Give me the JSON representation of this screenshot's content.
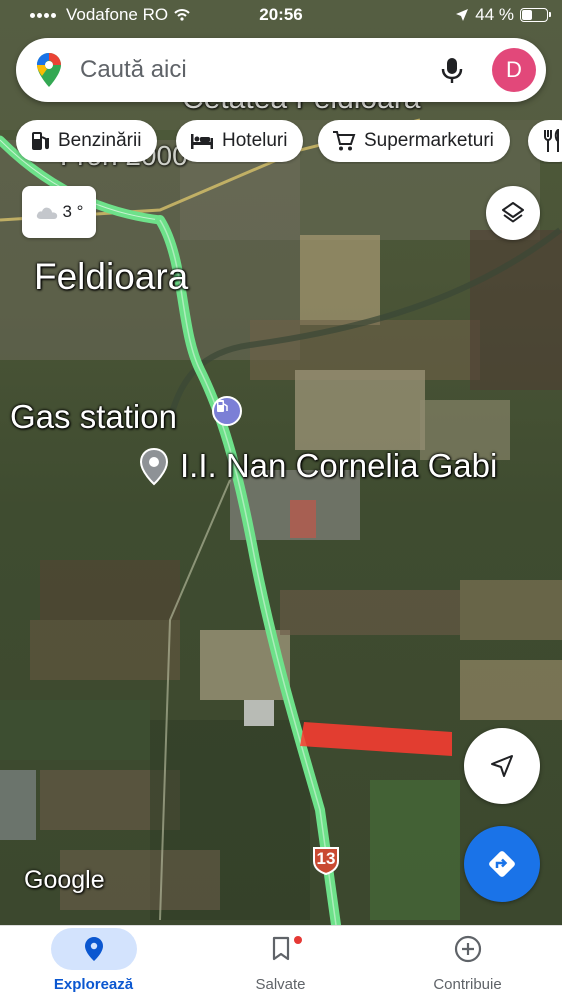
{
  "status_bar": {
    "carrier": "Vodafone RO",
    "time": "20:56",
    "battery": "44 %",
    "battery_level": 0.44
  },
  "search": {
    "placeholder": "Caută aici",
    "avatar_letter": "D",
    "avatar_color": "#e2487a"
  },
  "chips": [
    {
      "label": "Benzinării",
      "icon": "gas-pump-icon"
    },
    {
      "label": "Hoteluri",
      "icon": "bed-icon"
    },
    {
      "label": "Supermarketuri",
      "icon": "cart-icon"
    },
    {
      "label": "",
      "icon": "restaurant-icon"
    }
  ],
  "weather": {
    "temp": "3 °",
    "icon": "cloud-icon"
  },
  "map": {
    "labels": {
      "town": "Feldioara",
      "gas_station": "Gas station",
      "place": "I.I. Nan Cornelia Gabi",
      "top_partial_1": "Cetatea Feldioara",
      "top_partial_2": "Fron 2000"
    },
    "route_number": "13",
    "attribution": "Google",
    "road_color": "#6ee18a",
    "highlight_color": "#ff3b30"
  },
  "bottom_nav": [
    {
      "label": "Explorează",
      "icon": "location-pin-icon",
      "active": true
    },
    {
      "label": "Salvate",
      "icon": "bookmark-icon",
      "active": false
    },
    {
      "label": "Contribuie",
      "icon": "add-circle-icon",
      "active": false
    }
  ]
}
